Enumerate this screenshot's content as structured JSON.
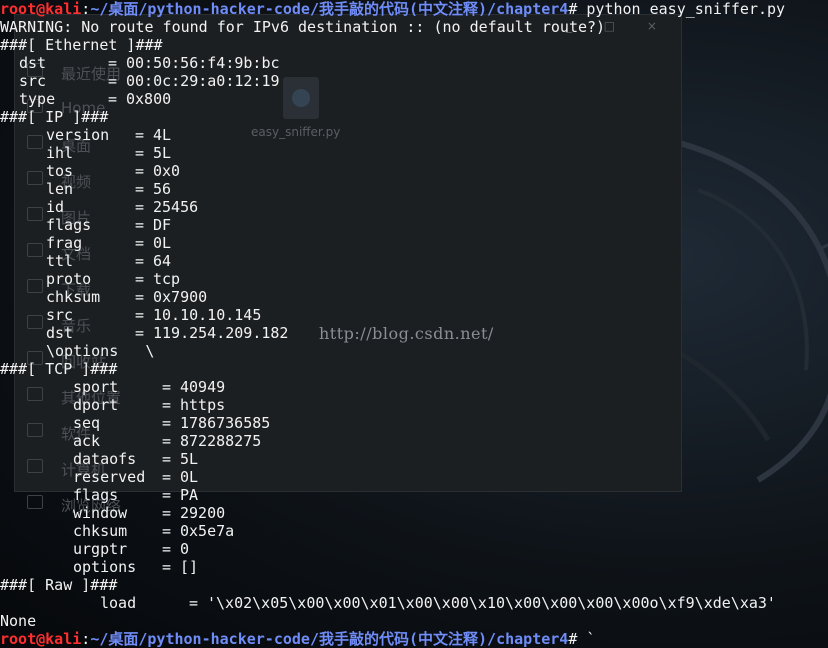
{
  "file_manager": {
    "window_buttons": "_ □ ×",
    "sidebar": [
      {
        "label": "最近使用",
        "icon": "clock-icon"
      },
      {
        "label": "Home",
        "icon": "home-icon"
      },
      {
        "label": "桌面",
        "icon": "desktop-icon"
      },
      {
        "label": "视频",
        "icon": "video-icon"
      },
      {
        "label": "图片",
        "icon": "image-icon"
      },
      {
        "label": "文档",
        "icon": "document-icon"
      },
      {
        "label": "下载",
        "icon": "download-icon"
      },
      {
        "label": "音乐",
        "icon": "music-icon"
      },
      {
        "label": "回收站",
        "icon": "trash-icon"
      },
      {
        "label": "其他位置",
        "icon": "folder-icon"
      },
      {
        "label": "软件",
        "icon": "software-icon"
      },
      {
        "label": "计算机",
        "icon": "computer-icon"
      },
      {
        "label": "浏览网络",
        "icon": "network-icon"
      }
    ],
    "file": {
      "name": "easy_sniffer.py",
      "icon": "python-file-icon"
    }
  },
  "watermark": "http://blog.csdn.net/",
  "prompt": {
    "user": "root@kali",
    "sep": ":",
    "path": "~/桌面/python-hacker-code/我手敲的代码(中文注释)/chapter4",
    "symbol": "#"
  },
  "command": " python easy_sniffer.py",
  "final_command": " `",
  "warning": "WARNING: No route found for IPv6 destination :: (no default route?)",
  "headers": {
    "ethernet": "###[ Ethernet ]###",
    "ip": "###[ IP ]###",
    "tcp": "###[ TCP ]###",
    "raw": "###[ Raw ]###"
  },
  "ethernet": [
    {
      "key": "dst",
      "value": "00:50:56:f4:9b:bc"
    },
    {
      "key": "src",
      "value": "00:0c:29:a0:12:19"
    },
    {
      "key": "type",
      "value": "0x800"
    }
  ],
  "ip": [
    {
      "key": "version",
      "value": "4L"
    },
    {
      "key": "ihl",
      "value": "5L"
    },
    {
      "key": "tos",
      "value": "0x0"
    },
    {
      "key": "len",
      "value": "56"
    },
    {
      "key": "id",
      "value": "25456"
    },
    {
      "key": "flags",
      "value": "DF"
    },
    {
      "key": "frag",
      "value": "0L"
    },
    {
      "key": "ttl",
      "value": "64"
    },
    {
      "key": "proto",
      "value": "tcp"
    },
    {
      "key": "chksum",
      "value": "0x7900"
    },
    {
      "key": "src",
      "value": "10.10.10.145"
    },
    {
      "key": "dst",
      "value": "119.254.209.182"
    }
  ],
  "ip_options": "\\options   \\",
  "tcp": [
    {
      "key": "sport",
      "value": "40949"
    },
    {
      "key": "dport",
      "value": "https"
    },
    {
      "key": "seq",
      "value": "1786736585"
    },
    {
      "key": "ack",
      "value": "872288275"
    },
    {
      "key": "dataofs",
      "value": "5L"
    },
    {
      "key": "reserved",
      "value": "0L"
    },
    {
      "key": "flags",
      "value": "PA"
    },
    {
      "key": "window",
      "value": "29200"
    },
    {
      "key": "chksum",
      "value": "0x5e7a"
    },
    {
      "key": "urgptr",
      "value": "0"
    },
    {
      "key": "options",
      "value": "[]"
    }
  ],
  "raw": [
    {
      "key": "load",
      "value": "'\\x02\\x05\\x00\\x00\\x01\\x00\\x00\\x10\\x00\\x00\\x00\\x00o\\xf9\\xde\\xa3'"
    }
  ],
  "none_line": "None",
  "colors": {
    "user": "#ff2f2f",
    "path": "#6f8cf7",
    "text": "#f2f2f2",
    "background": "#0e1318"
  }
}
